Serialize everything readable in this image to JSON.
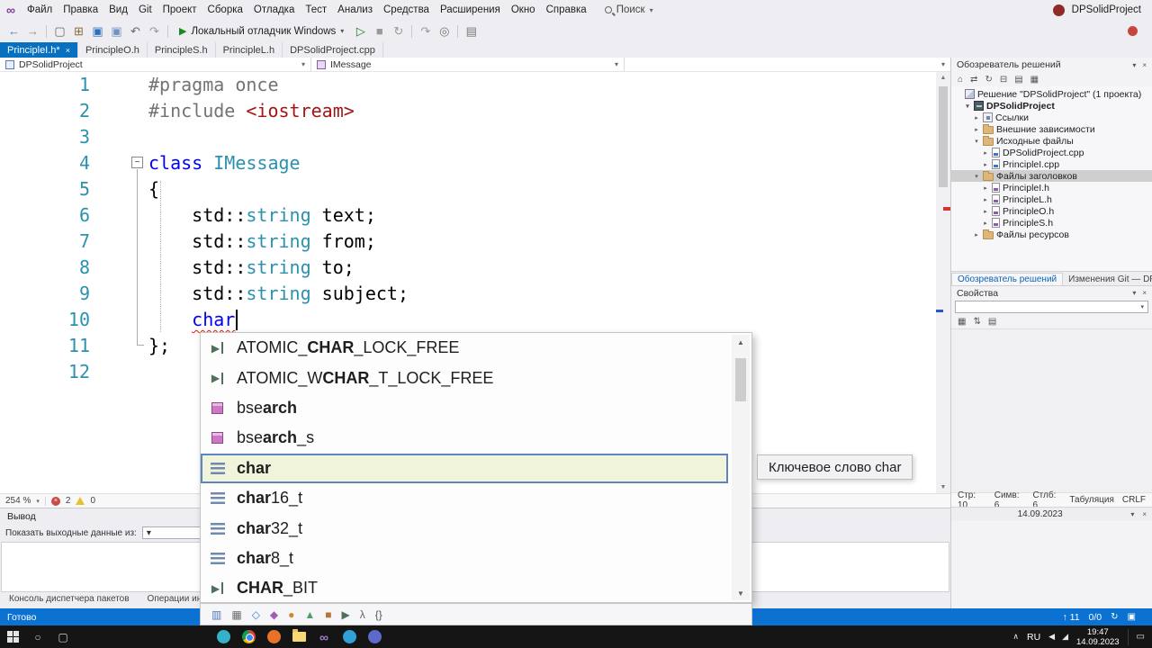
{
  "glyphs": {
    "caret_down": "▾",
    "close": "×",
    "up": "▲",
    "down": "▼",
    "minus": "−"
  },
  "menu": {
    "logo_icon": "∞",
    "items": [
      "Файл",
      "Правка",
      "Вид",
      "Git",
      "Проект",
      "Сборка",
      "Отладка",
      "Тест",
      "Анализ",
      "Средства",
      "Расширения",
      "Окно",
      "Справка"
    ],
    "search_label": "Поиск",
    "title": "DPSolidProject"
  },
  "toolbar": {
    "left_icons": [
      {
        "n": "nav-back-icon",
        "g": "←",
        "c": "#3C79D8"
      },
      {
        "n": "nav-forward-icon",
        "g": "→",
        "c": "#8A8A8A"
      },
      {
        "n": "toolbar-separator",
        "sep": true
      },
      {
        "n": "new-project-icon",
        "g": "▢",
        "c": "#666666"
      },
      {
        "n": "open-file-icon",
        "g": "⊞",
        "c": "#8A6D3B"
      },
      {
        "n": "save-icon",
        "g": "▣",
        "c": "#2F6FBF"
      },
      {
        "n": "save-all-icon",
        "g": "▣",
        "c": "#6F93C4"
      },
      {
        "n": "undo-icon",
        "g": "↶",
        "c": "#666666"
      },
      {
        "n": "redo-icon",
        "g": "↷",
        "c": "#9A9A9A"
      },
      {
        "n": "toolbar-separator",
        "sep": true
      }
    ],
    "run_play": "▶",
    "run_label": "Локальный отладчик Windows",
    "right_icons": [
      {
        "n": "run-no-debug-icon",
        "g": "▷",
        "c": "#1A7A2A"
      },
      {
        "n": "stop-icon",
        "g": "■",
        "c": "#999999"
      },
      {
        "n": "restart-icon",
        "g": "↻",
        "c": "#999999"
      },
      {
        "n": "toolbar-separator",
        "sep": true
      },
      {
        "n": "step-over-icon",
        "g": "↷",
        "c": "#999999"
      },
      {
        "n": "find-icon",
        "g": "◎",
        "c": "#777777"
      },
      {
        "n": "toolbar-separator",
        "sep": true
      },
      {
        "n": "extensions-icon",
        "g": "▤",
        "c": "#777777"
      }
    ]
  },
  "tabs": [
    {
      "label": "PrincipleI.h*",
      "active": true
    },
    {
      "label": "PrincipleO.h"
    },
    {
      "label": "PrincipleS.h"
    },
    {
      "label": "PrincipleL.h"
    },
    {
      "label": "DPSolidProject.cpp"
    }
  ],
  "navbar": {
    "project": "DPSolidProject",
    "scope": "IMessage"
  },
  "editor": {
    "zoom": "254 %",
    "error_count": "2",
    "warning_count": "0",
    "lines": [
      {
        "num": "1",
        "segs": [
          {
            "t": "#pragma once",
            "c": "pp"
          }
        ]
      },
      {
        "num": "2",
        "segs": [
          {
            "t": "#include ",
            "c": "pp"
          },
          {
            "t": "<iostream>",
            "c": "str"
          }
        ]
      },
      {
        "num": "3",
        "segs": []
      },
      {
        "num": "4",
        "segs": [
          {
            "t": "class ",
            "c": "kw"
          },
          {
            "t": "IMessage",
            "c": "type"
          }
        ]
      },
      {
        "num": "5",
        "segs": [
          {
            "t": "{",
            "c": "pl"
          }
        ]
      },
      {
        "num": "6",
        "segs": [
          {
            "t": "    ",
            "c": "pl"
          },
          {
            "t": "std::",
            "c": "pl"
          },
          {
            "t": "string",
            "c": "type"
          },
          {
            "t": " text;",
            "c": "pl"
          }
        ]
      },
      {
        "num": "7",
        "segs": [
          {
            "t": "    ",
            "c": "pl"
          },
          {
            "t": "std::",
            "c": "pl"
          },
          {
            "t": "string",
            "c": "type"
          },
          {
            "t": " from;",
            "c": "pl"
          }
        ]
      },
      {
        "num": "8",
        "segs": [
          {
            "t": "    ",
            "c": "pl"
          },
          {
            "t": "std::",
            "c": "pl"
          },
          {
            "t": "string",
            "c": "type"
          },
          {
            "t": " to;",
            "c": "pl"
          }
        ]
      },
      {
        "num": "9",
        "segs": [
          {
            "t": "    ",
            "c": "pl"
          },
          {
            "t": "std::",
            "c": "pl"
          },
          {
            "t": "string",
            "c": "type"
          },
          {
            "t": " subject;",
            "c": "pl"
          }
        ]
      },
      {
        "num": "10",
        "caret": true,
        "segs": [
          {
            "t": "    ",
            "c": "pl"
          },
          {
            "t": "char",
            "c": "kw",
            "sq": true
          }
        ]
      },
      {
        "num": "11",
        "segs": [
          {
            "t": "};",
            "c": "pl"
          }
        ]
      },
      {
        "num": "12",
        "segs": []
      }
    ]
  },
  "completion": {
    "tooltip": "Ключевое слово char",
    "items": [
      {
        "kind": "macro",
        "parts": [
          {
            "t": "ATOMIC_"
          },
          {
            "t": "CHAR",
            "b": true
          },
          {
            "t": "_LOCK_FREE"
          }
        ]
      },
      {
        "kind": "macro",
        "parts": [
          {
            "t": "ATOMIC_W"
          },
          {
            "t": "CHAR",
            "b": true
          },
          {
            "t": "_T_LOCK_FREE"
          }
        ]
      },
      {
        "kind": "function",
        "parts": [
          {
            "t": "bse"
          },
          {
            "t": "arch",
            "b": true
          }
        ]
      },
      {
        "kind": "function",
        "parts": [
          {
            "t": "bse"
          },
          {
            "t": "arch",
            "b": true
          },
          {
            "t": "_s"
          }
        ]
      },
      {
        "kind": "keyword",
        "selected": true,
        "parts": [
          {
            "t": "char",
            "b": true
          }
        ]
      },
      {
        "kind": "keyword",
        "parts": [
          {
            "t": "char",
            "b": true
          },
          {
            "t": "16_t"
          }
        ]
      },
      {
        "kind": "keyword",
        "parts": [
          {
            "t": "char",
            "b": true
          },
          {
            "t": "32_t"
          }
        ]
      },
      {
        "kind": "keyword",
        "parts": [
          {
            "t": "char",
            "b": true
          },
          {
            "t": "8_t"
          }
        ]
      },
      {
        "kind": "macro",
        "parts": [
          {
            "t": "CHAR",
            "b": true
          },
          {
            "t": "_BIT"
          }
        ]
      }
    ],
    "filters": [
      {
        "n": "filter-locals-icon",
        "g": "▥",
        "c": "#4A78C2"
      },
      {
        "n": "filter-constants-icon",
        "g": "▦",
        "c": "#6A6A6A"
      },
      {
        "n": "filter-properties-icon",
        "g": "◇",
        "c": "#3C82C8"
      },
      {
        "n": "filter-methods-icon",
        "g": "◆",
        "c": "#A45BB5"
      },
      {
        "n": "filter-classes-icon",
        "g": "●",
        "c": "#C98B2D"
      },
      {
        "n": "filter-structs-icon",
        "g": "▲",
        "c": "#4C9E73"
      },
      {
        "n": "filter-enums-icon",
        "g": "■",
        "c": "#B3763B"
      },
      {
        "n": "filter-macros-icon",
        "g": "▶",
        "c": "#4F705B"
      },
      {
        "n": "filter-keywords-icon",
        "g": "λ",
        "c": "#666666"
      },
      {
        "n": "filter-snippets-icon",
        "g": "{}",
        "c": "#555555"
      }
    ]
  },
  "solution_explorer": {
    "title": "Обозреватель решений",
    "toolbar_icons": [
      {
        "n": "home-icon",
        "g": "⌂"
      },
      {
        "n": "switch-views-icon",
        "g": "⇄"
      },
      {
        "n": "refresh-icon",
        "g": "↻"
      },
      {
        "n": "collapse-all-icon",
        "g": "⊟"
      },
      {
        "n": "show-all-files-icon",
        "g": "▤"
      },
      {
        "n": "properties-icon",
        "g": "▦"
      }
    ],
    "tree": [
      {
        "label": "Решение \"DPSolidProject\" (1 проекта)",
        "icon": "solution",
        "indent": 0
      },
      {
        "label": "DPSolidProject",
        "icon": "project",
        "indent": 1,
        "expander": "expanded",
        "bold": true
      },
      {
        "label": "Ссылки",
        "icon": "references",
        "indent": 2,
        "expander": "collapsed"
      },
      {
        "label": "Внешние зависимости",
        "icon": "folder",
        "indent": 2,
        "expander": "collapsed"
      },
      {
        "label": "Исходные файлы",
        "icon": "folder",
        "indent": 2,
        "expander": "expanded"
      },
      {
        "label": "DPSolidProject.cpp",
        "icon": "cpp",
        "indent": 3,
        "expander": "collapsed"
      },
      {
        "label": "PrincipleI.cpp",
        "icon": "cpp",
        "indent": 3,
        "expander": "collapsed"
      },
      {
        "label": "Файлы заголовков",
        "icon": "folder",
        "indent": 2,
        "expander": "expanded",
        "selected": true
      },
      {
        "label": "PrincipleI.h",
        "icon": "header",
        "indent": 3,
        "expander": "collapsed"
      },
      {
        "label": "PrincipleL.h",
        "icon": "header",
        "indent": 3,
        "expander": "collapsed"
      },
      {
        "label": "PrincipleO.h",
        "icon": "header",
        "indent": 3,
        "expander": "collapsed"
      },
      {
        "label": "PrincipleS.h",
        "icon": "header",
        "indent": 3,
        "expander": "collapsed"
      },
      {
        "label": "Файлы ресурсов",
        "icon": "folder",
        "indent": 2,
        "expander": "collapsed"
      }
    ],
    "bottom_tabs": [
      "Обозреватель решений",
      "Изменения Git — DPSolid..."
    ]
  },
  "properties_panel": {
    "title": "Свойства",
    "toolbar_icons": [
      {
        "n": "categorized-icon",
        "g": "▦"
      },
      {
        "n": "alphabetical-icon",
        "g": "⇅"
      },
      {
        "n": "property-pages-icon",
        "g": "▤"
      }
    ]
  },
  "doc_status": {
    "line": "Стр: 10",
    "chars": "Симв: 6",
    "col": "Стлб: 6",
    "tabs": "Табуляция",
    "eol": "CRLF"
  },
  "git_strip": {
    "date": "14.09.2023"
  },
  "output_panel": {
    "title": "Вывод",
    "show_label": "Показать выходные данные из:",
    "toolbar_icons": [
      {
        "n": "word-wrap-icon",
        "g": "▤"
      },
      {
        "n": "clear-output-icon",
        "g": "⊟"
      },
      {
        "n": "close-output-icon",
        "g": "×"
      }
    ],
    "tabs": [
      "Консоль диспетчера пакетов",
      "Операции инструментария"
    ]
  },
  "status_bar": {
    "ready": "Готово",
    "counter_up": "↑ 11",
    "counter_ratio": "0/0",
    "icons": [
      {
        "n": "sync-icon",
        "g": "↻"
      },
      {
        "n": "notifications-icon",
        "g": "▣"
      }
    ]
  },
  "taskbar": {
    "system_icons": [
      {
        "n": "taskbar-search-icon",
        "g": "○"
      },
      {
        "n": "task-view-icon",
        "g": "▢"
      }
    ],
    "app_icons": [
      {
        "n": "edge-icon",
        "style": "circle",
        "c": "#35B2C8"
      },
      {
        "n": "chrome-icon",
        "style": "chrome"
      },
      {
        "n": "firefox-icon",
        "style": "circle",
        "c": "#E8722A"
      },
      {
        "n": "explorer-icon",
        "style": "folder"
      },
      {
        "n": "visual-studio-icon",
        "style": "glyph",
        "g": "∞",
        "c": "#A77BD6"
      },
      {
        "n": "telegram-icon",
        "style": "circle",
        "c": "#31A0D8"
      },
      {
        "n": "discord-icon",
        "style": "circle",
        "c": "#5E6AC9"
      }
    ],
    "tray": {
      "caret": "∧",
      "lang": "RU",
      "icons": [
        {
          "n": "volume-icon",
          "g": "◀"
        },
        {
          "n": "network-icon",
          "g": "◢"
        }
      ],
      "time": "19:47",
      "date": "14.09.2023",
      "action_center_icon": "▭"
    }
  }
}
